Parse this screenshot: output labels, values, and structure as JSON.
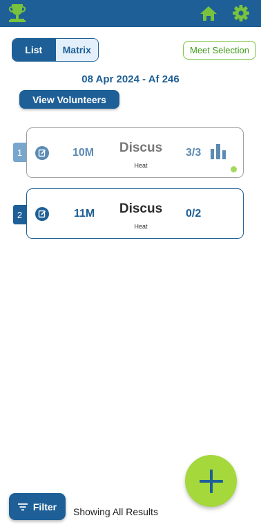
{
  "header": {
    "logo_icon": "trophy-icon",
    "home_icon": "home-icon",
    "settings_icon": "gear-icon",
    "bar_color": "#1d5f96",
    "icon_color": "#79c23e"
  },
  "view_toggle": {
    "list_label": "List",
    "matrix_label": "Matrix",
    "selected": "List"
  },
  "meet_selection_label": "Meet Selection",
  "meet_title": "08 Apr 2024 - Af 246",
  "view_volunteers_label": "View Volunteers",
  "events": [
    {
      "number": "1",
      "distance": "10M",
      "event": "Discus",
      "type": "Heat",
      "count": "3/3",
      "has_chart": true,
      "status": "complete"
    },
    {
      "number": "2",
      "distance": "11M",
      "event": "Discus",
      "type": "Heat",
      "count": "0/2",
      "has_chart": false,
      "status": ""
    }
  ],
  "add_button_icon": "plus-icon",
  "filter": {
    "label": "Filter",
    "icon": "filter-lines-icon"
  },
  "results_text": "Showing All Results",
  "colors": {
    "primary": "#1d5f96",
    "accent": "#a4d83b"
  }
}
